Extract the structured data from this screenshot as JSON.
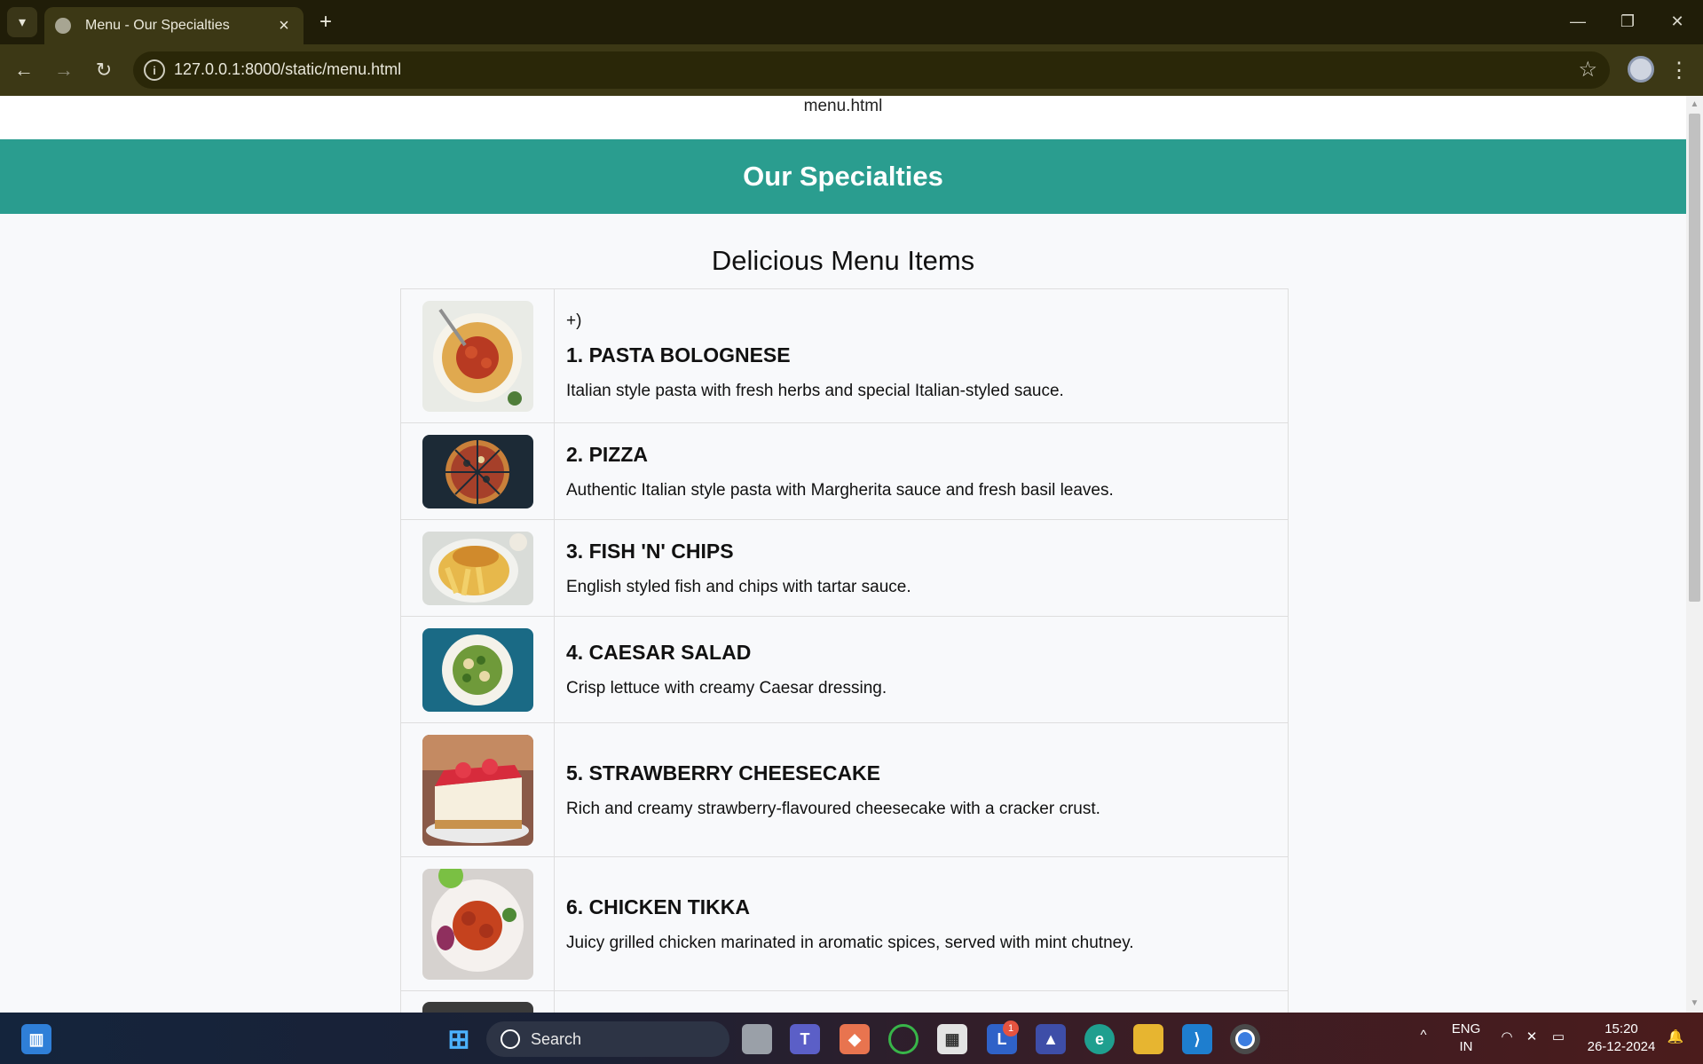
{
  "browser": {
    "tab_title": "Menu - Our Specialties",
    "url": "127.0.0.1:8000/static/menu.html"
  },
  "page": {
    "file_label": "menu.html",
    "banner_title": "Our Specialties",
    "subheading": "Delicious Menu Items",
    "stray_text": "+)",
    "items": [
      {
        "title": "1. PASTA BOLOGNESE",
        "desc": "Italian style pasta with fresh herbs and special Italian-styled sauce."
      },
      {
        "title": "2. PIZZA",
        "desc": "Authentic Italian style pasta with Margherita sauce and fresh basil leaves."
      },
      {
        "title": "3. FISH 'N' CHIPS",
        "desc": "English styled fish and chips with tartar sauce."
      },
      {
        "title": "4. CAESAR SALAD",
        "desc": "Crisp lettuce with creamy Caesar dressing."
      },
      {
        "title": "5. STRAWBERRY CHEESECAKE",
        "desc": "Rich and creamy strawberry-flavoured cheesecake with a cracker crust."
      },
      {
        "title": "6. CHICKEN TIKKA",
        "desc": "Juicy grilled chicken marinated in aromatic spices, served with mint chutney."
      }
    ]
  },
  "taskbar": {
    "search_placeholder": "Search",
    "lang_line1": "ENG",
    "lang_line2": "IN",
    "time": "15:20",
    "date": "26-12-2024",
    "badge_count": "1"
  }
}
